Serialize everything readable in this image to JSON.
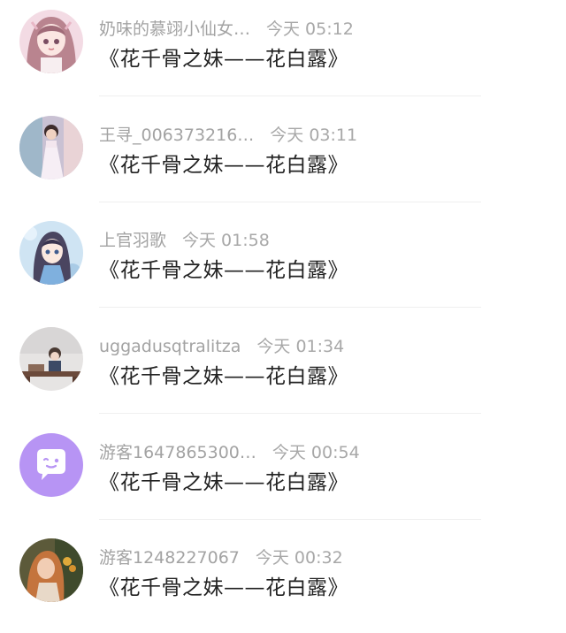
{
  "comments": [
    {
      "username": "奶味的慕翊小仙女…",
      "time": "今天 05:12",
      "message": "《花千骨之妹——花白露》",
      "avatar_icon": "anime-girl-pink-avatar-icon"
    },
    {
      "username": "王寻_006373216…",
      "time": "今天 03:11",
      "message": "《花千骨之妹——花白露》",
      "avatar_icon": "girl-photo-avatar-icon"
    },
    {
      "username": "上官羽歌",
      "time": "今天 01:58",
      "message": "《花千骨之妹——花白露》",
      "avatar_icon": "anime-girl-blue-avatar-icon"
    },
    {
      "username": "uggadusqtralitza",
      "time": "今天 01:34",
      "message": "《花千骨之妹——花白露》",
      "avatar_icon": "boy-at-desk-avatar-icon"
    },
    {
      "username": "游客1647865300…",
      "time": "今天 00:54",
      "message": "《花千骨之妹——花白露》",
      "avatar_icon": "default-chat-bubble-avatar-icon"
    },
    {
      "username": "游客1248227067",
      "time": "今天 00:32",
      "message": "《花千骨之妹——花白露》",
      "avatar_icon": "woman-painting-avatar-icon"
    }
  ],
  "colors": {
    "username": "#a3a3a3",
    "time": "#a8a8a8",
    "message": "#222222",
    "divider": "#efefef",
    "default_avatar": "#b794f4"
  }
}
